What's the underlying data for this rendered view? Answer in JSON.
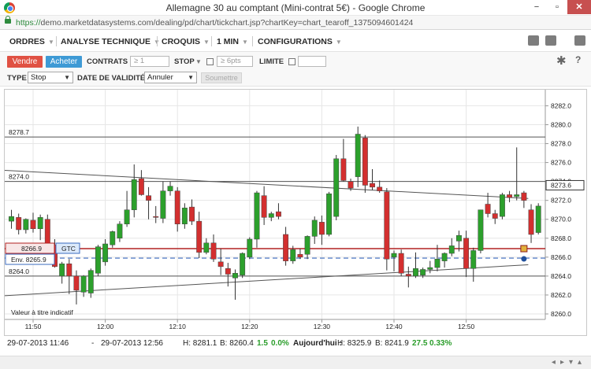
{
  "window": {
    "title": "Allemagne 30 au comptant (Mini-contrat 5€) - Google Chrome",
    "min": "−",
    "max": "▫",
    "close": "✕"
  },
  "url": {
    "scheme": "https://",
    "rest": "demo.marketdatasystems.com/dealing/pd/chart/tickchart.jsp?chartKey=chart_tearoff_1375094601424"
  },
  "menu": {
    "items": [
      "ORDRES",
      "ANALYSE TECHNIQUE",
      "CROQUIS",
      "1 MIN",
      "CONFIGURATIONS"
    ],
    "caret": "▼",
    "icons": [
      "camera-icon",
      "print-icon",
      "expand-icon",
      "gear-icon",
      "help-icon"
    ],
    "gear_glyph": "✱",
    "help_glyph": "?"
  },
  "order": {
    "sell": "Vendre",
    "buy": "Acheter",
    "contracts_label": "CONTRATS",
    "contracts_placeholder": "≥ 1",
    "stop_label": "STOP",
    "stop_placeholder": "≥ 6pts",
    "limit_label": "LIMITE"
  },
  "type_row": {
    "type_label": "TYPE",
    "type_value": "Stop",
    "validity_label": "DATE DE VALIDITÉ",
    "validity_value": "Annuler",
    "submit": "Soumettre"
  },
  "chart": {
    "indicative": "Valeur à titre indicatif",
    "current_price": "8273.6",
    "left_labels": [
      "8278.7",
      "8274.0",
      "8264.0"
    ],
    "order_stop_price": "8266.9",
    "order_tag": "GTC",
    "order_env": "Env. 8265.9"
  },
  "chart_data": {
    "type": "candlestick",
    "y_ticks": [
      "8282.0",
      "8280.0",
      "8278.0",
      "8276.0",
      "8274.0",
      "8272.0",
      "8270.0",
      "8268.0",
      "8266.0",
      "8264.0",
      "8262.0",
      "8260.0"
    ],
    "ylim": [
      8259.5,
      8283.2
    ],
    "x_ticks": [
      "11:50",
      "12:00",
      "12:10",
      "12:20",
      "12:30",
      "12:40",
      "12:50"
    ],
    "x_tick_minutes": [
      0,
      10,
      20,
      30,
      40,
      50,
      60
    ],
    "horizontal_lines": [
      8278.7,
      8274.0,
      8264.0
    ],
    "stop_level": 8266.9,
    "order_level": 8265.9,
    "trendlines": [
      {
        "from": [
          -4.5,
          8275.2
        ],
        "to": [
          68.6,
          8272.2
        ]
      },
      {
        "from": [
          -4.5,
          8261.9
        ],
        "to": [
          68.6,
          8265.2
        ]
      }
    ],
    "candles": [
      [
        -4,
        8269.5,
        8270.3,
        8268.5,
        8269.7
      ],
      [
        -3,
        8269.8,
        8271.0,
        8269.0,
        8270.3
      ],
      [
        -2,
        8270.2,
        8270.6,
        8268.4,
        8268.9
      ],
      [
        -1,
        8268.9,
        8270.1,
        8268.5,
        8270.0
      ],
      [
        0,
        8269.9,
        8270.7,
        8268.6,
        8269.0
      ],
      [
        1,
        8269.0,
        8270.5,
        8267.8,
        8270.2
      ],
      [
        2,
        8270.0,
        8270.5,
        8267.0,
        8267.3
      ],
      [
        3,
        8267.3,
        8267.9,
        8264.9,
        8265.0
      ],
      [
        4,
        8264.0,
        8265.5,
        8263.2,
        8265.3
      ],
      [
        5,
        8265.3,
        8265.8,
        8262.1,
        8264.0
      ],
      [
        6,
        8264.0,
        8264.6,
        8261.0,
        8262.5
      ],
      [
        7,
        8262.3,
        8264.1,
        8261.8,
        8264.0
      ],
      [
        8,
        8262.2,
        8264.8,
        8261.7,
        8264.6
      ],
      [
        9,
        8264.3,
        8267.3,
        8264.0,
        8267.1
      ],
      [
        10,
        8265.5,
        8267.9,
        8265.1,
        8267.4
      ],
      [
        11,
        8267.3,
        8268.8,
        8267.0,
        8268.7
      ],
      [
        12,
        8268.0,
        8269.8,
        8267.6,
        8269.5
      ],
      [
        13,
        8269.5,
        8273.0,
        8269.2,
        8271.0
      ],
      [
        14,
        8271.0,
        8275.8,
        8270.2,
        8274.2
      ],
      [
        15,
        8274.3,
        8275.2,
        8272.5,
        8272.6
      ],
      [
        16,
        8272.5,
        8273.4,
        8270.0,
        8272.0
      ],
      [
        17,
        8270.3,
        8271.4,
        8269.6,
        8270.2
      ],
      [
        18,
        8270.1,
        8274.0,
        8269.6,
        8273.0
      ],
      [
        19,
        8273.0,
        8274.0,
        8272.5,
        8273.5
      ],
      [
        20,
        8273.0,
        8273.4,
        8268.7,
        8269.5
      ],
      [
        21,
        8269.5,
        8271.7,
        8269.0,
        8271.2
      ],
      [
        22,
        8271.3,
        8272.1,
        8269.4,
        8269.8
      ],
      [
        23,
        8269.8,
        8270.8,
        8265.9,
        8266.5
      ],
      [
        24,
        8266.5,
        8268.0,
        8266.3,
        8267.5
      ],
      [
        25,
        8267.5,
        8268.4,
        8265.5,
        8265.8
      ],
      [
        26,
        8265.5,
        8266.9,
        8264.1,
        8265.0
      ],
      [
        27,
        8264.8,
        8265.4,
        8262.9,
        8264.2
      ],
      [
        28,
        8263.8,
        8264.7,
        8261.5,
        8264.3
      ],
      [
        29,
        8264.1,
        8266.5,
        8263.8,
        8266.4
      ],
      [
        30,
        8266.0,
        8268.1,
        8265.8,
        8267.9
      ],
      [
        31,
        8267.9,
        8273.0,
        8267.0,
        8272.8
      ],
      [
        32,
        8272.5,
        8273.5,
        8269.4,
        8270.2
      ],
      [
        33,
        8270.2,
        8270.8,
        8269.8,
        8270.6
      ],
      [
        34,
        8270.8,
        8271.7,
        8270.0,
        8270.3
      ],
      [
        35,
        8268.4,
        8269.2,
        8265.1,
        8265.6
      ],
      [
        36,
        8265.6,
        8267.2,
        8265.3,
        8266.8
      ],
      [
        37,
        8266.3,
        8266.9,
        8265.8,
        8266.0
      ],
      [
        38,
        8266.3,
        8268.3,
        8265.8,
        8268.2
      ],
      [
        39,
        8268.2,
        8270.3,
        8267.4,
        8269.9
      ],
      [
        40,
        8269.7,
        8270.4,
        8267.3,
        8268.4
      ],
      [
        41,
        8268.4,
        8272.9,
        8268.2,
        8272.7
      ],
      [
        42,
        8270.3,
        8276.8,
        8269.9,
        8276.4
      ],
      [
        43,
        8276.4,
        8278.5,
        8274.0,
        8274.1
      ],
      [
        44,
        8274.0,
        8274.3,
        8273.0,
        8273.3
      ],
      [
        45,
        8274.5,
        8279.8,
        8273.4,
        8279.0
      ],
      [
        46,
        8278.6,
        8278.9,
        8272.8,
        8273.6
      ],
      [
        47,
        8273.8,
        8275.3,
        8273.1,
        8273.4
      ],
      [
        48,
        8273.4,
        8274.1,
        8272.8,
        8273.0
      ],
      [
        49,
        8272.9,
        8273.3,
        8264.6,
        8265.8
      ],
      [
        50,
        8266.0,
        8266.7,
        8264.5,
        8266.4
      ],
      [
        51,
        8266.4,
        8266.8,
        8264.0,
        8264.3
      ],
      [
        52,
        8264.2,
        8265.0,
        8262.8,
        8264.0
      ],
      [
        53,
        8264.0,
        8266.5,
        8263.8,
        8264.8
      ],
      [
        54,
        8264.1,
        8264.9,
        8263.8,
        8264.7
      ],
      [
        55,
        8264.7,
        8265.6,
        8264.3,
        8264.9
      ],
      [
        56,
        8264.9,
        8267.3,
        8264.5,
        8265.8
      ],
      [
        57,
        8265.6,
        8266.5,
        8264.9,
        8266.4
      ],
      [
        58,
        8266.4,
        8268.0,
        8266.1,
        8267.2
      ],
      [
        59,
        8267.7,
        8268.8,
        8266.6,
        8268.3
      ],
      [
        60,
        8268.0,
        8268.8,
        8263.9,
        8264.8
      ],
      [
        61,
        8264.8,
        8267.0,
        8263.4,
        8266.7
      ],
      [
        62,
        8266.7,
        8271.0,
        8266.4,
        8271.0
      ],
      [
        63,
        8271.6,
        8272.8,
        8270.2,
        8270.6
      ],
      [
        64,
        8270.6,
        8271.0,
        8269.5,
        8270.1
      ],
      [
        65,
        8270.3,
        8272.8,
        8270.0,
        8272.6
      ],
      [
        66,
        8272.6,
        8273.0,
        8271.8,
        8272.3
      ],
      [
        67,
        8272.4,
        8277.6,
        8272.0,
        8272.6
      ],
      [
        68,
        8272.8,
        8273.0,
        8271.2,
        8272.0
      ],
      [
        69,
        8271.0,
        8271.6,
        8267.5,
        8268.4
      ],
      [
        70,
        8268.6,
        8271.7,
        8268.4,
        8271.4
      ],
      [
        71,
        8271.6,
        8273.2,
        8271.0,
        8272.3
      ],
      [
        72,
        8272.4,
        8273.8,
        8272.2,
        8273.6
      ]
    ]
  },
  "footer": {
    "from": "29-07-2013 11:46",
    "sep": "-",
    "to": "29-07-2013 12:56",
    "high": "H: 8281.1",
    "low": "B: 8260.4",
    "change": "1.5",
    "change_pct": "0.0%",
    "today_label": "Aujourd'hui :",
    "today_high": "H: 8325.9",
    "today_low": "B: 8241.9",
    "today_change": "27.5",
    "today_change_pct": "0.33%"
  },
  "colors": {
    "up": "#2ca02c",
    "down": "#d32f2f",
    "stop_line": "#b22222",
    "order_line": "#3b6bbf",
    "grid": "#e6e6e6"
  }
}
